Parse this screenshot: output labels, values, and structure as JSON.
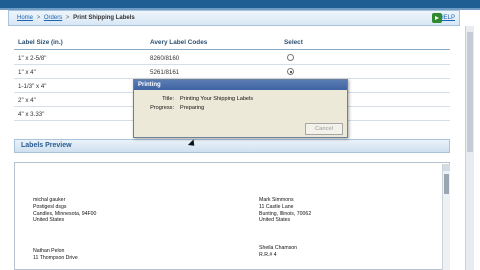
{
  "breadcrumb": {
    "items": [
      "Home",
      "Orders",
      "Print Shipping Labels"
    ],
    "help_label": "HELP"
  },
  "labels_table": {
    "headers": [
      "Label Size (in.)",
      "Avery Label Codes",
      "Select"
    ],
    "rows": [
      {
        "size": "1\" x 2-5/8\"",
        "codes": "8260/8160",
        "selected": false
      },
      {
        "size": "1\" x 4\"",
        "codes": "5261/8161",
        "selected": true
      },
      {
        "size": "1-1/3\" x 4\"",
        "codes": "",
        "selected": false
      },
      {
        "size": "2\" x 4\"",
        "codes": "",
        "selected": false
      },
      {
        "size": "4\" x 3.33\"",
        "codes": "",
        "selected": false
      }
    ]
  },
  "preview": {
    "title": "Labels Preview",
    "addresses": [
      {
        "line1": "michal gauker",
        "line2": "Postigesl dsgs",
        "line3": "Candles, Minnesota, 94F00",
        "line4": "United States"
      },
      {
        "line1": "Mark Simmons",
        "line2": "11 Castle Lane",
        "line3": "Bunting, Illinois, 70062",
        "line4": "United States"
      },
      {
        "line1": "Nathan Pelon",
        "line2": "11 Thompson Drive",
        "line3": "",
        "line4": ""
      },
      {
        "line1": "Sheila Chamson",
        "line2": "R.R.# 4",
        "line3": "",
        "line4": ""
      }
    ]
  },
  "dialog": {
    "title": "Printing",
    "title_label": "Title:",
    "title_value": "Printing Your Shipping Labels",
    "progress_label": "Progress:",
    "progress_value": "Preparing",
    "cancel_label": "Cancel"
  }
}
